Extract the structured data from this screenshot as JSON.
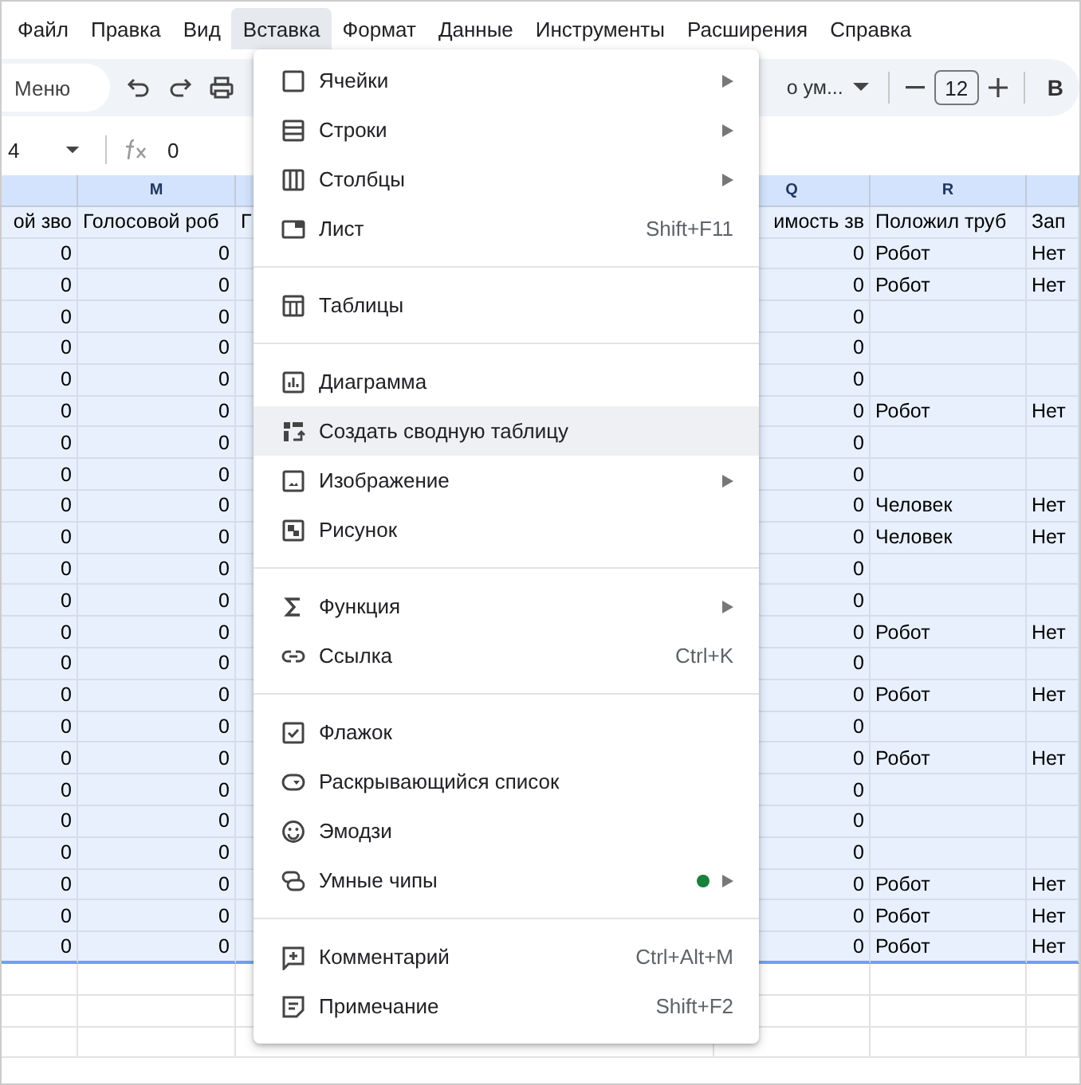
{
  "menubar": [
    {
      "label": "Файл",
      "selected": false
    },
    {
      "label": "Правка",
      "selected": false
    },
    {
      "label": "Вид",
      "selected": false
    },
    {
      "label": "Вставка",
      "selected": true
    },
    {
      "label": "Формат",
      "selected": false
    },
    {
      "label": "Данные",
      "selected": false
    },
    {
      "label": "Инструменты",
      "selected": false
    },
    {
      "label": "Расширения",
      "selected": false
    },
    {
      "label": "Справка",
      "selected": false
    }
  ],
  "toolbar": {
    "search": {
      "placeholder": "Меню"
    },
    "font": "о ум...",
    "font_size": "12",
    "bold": "B"
  },
  "formula_bar": {
    "cell_ref": "4",
    "value": "0"
  },
  "columns": [
    {
      "header": "ой зво"
    },
    {
      "letter": "M",
      "header": "Голосовой роб"
    },
    {
      "header": "Г"
    },
    {
      "letter": "Q",
      "header": "имость зв"
    },
    {
      "letter": "R",
      "header": "Положил труб"
    },
    {
      "header": "Зап"
    }
  ],
  "rows": [
    {
      "cells": [
        "0",
        "0",
        "0",
        "Робот",
        "Нет"
      ]
    },
    {
      "cells": [
        "0",
        "0",
        "0",
        "Робот",
        "Нет"
      ]
    },
    {
      "cells": [
        "0",
        "0",
        "0"
      ]
    },
    {
      "cells": [
        "0",
        "0",
        "0"
      ]
    },
    {
      "cells": [
        "0",
        "0",
        "0"
      ]
    },
    {
      "cells": [
        "0",
        "0",
        "0",
        "Робот",
        "Нет"
      ]
    },
    {
      "cells": [
        "0",
        "0",
        "0"
      ]
    },
    {
      "cells": [
        "0",
        "0",
        "0"
      ]
    },
    {
      "cells": [
        "0",
        "0",
        "0",
        "Человек",
        "Нет"
      ]
    },
    {
      "cells": [
        "0",
        "0",
        "0",
        "Человек",
        "Нет"
      ]
    },
    {
      "cells": [
        "0",
        "0",
        "0"
      ]
    },
    {
      "cells": [
        "0",
        "0",
        "0"
      ]
    },
    {
      "cells": [
        "0",
        "0",
        "0",
        "Робот",
        "Нет"
      ]
    },
    {
      "cells": [
        "0",
        "0",
        "0"
      ]
    },
    {
      "cells": [
        "0",
        "0",
        "0",
        "Робот",
        "Нет"
      ]
    },
    {
      "cells": [
        "0",
        "0",
        "0"
      ]
    },
    {
      "cells": [
        "0",
        "0",
        "0",
        "Робот",
        "Нет"
      ]
    },
    {
      "cells": [
        "0",
        "0",
        "0"
      ]
    },
    {
      "cells": [
        "0",
        "0",
        "0"
      ]
    },
    {
      "cells": [
        "0",
        "0",
        "0"
      ]
    },
    {
      "cells": [
        "0",
        "0",
        "0",
        "Робот",
        "Нет"
      ]
    },
    {
      "cells": [
        "0",
        "0",
        "0",
        "Робот",
        "Нет"
      ]
    },
    {
      "cells": [
        "0",
        "0",
        "0",
        "Робот",
        "Нет"
      ]
    }
  ],
  "menu": {
    "groups": [
      [
        {
          "label": "Ячейки",
          "submenu": true,
          "selected": false,
          "dot": false
        },
        {
          "label": "Строки",
          "submenu": true,
          "selected": false,
          "dot": false
        },
        {
          "label": "Столбцы",
          "submenu": true,
          "selected": false,
          "dot": false
        },
        {
          "label": "Лист",
          "shortcut": "Shift+F11",
          "submenu": false,
          "selected": false,
          "dot": false
        }
      ],
      [
        {
          "label": "Таблицы",
          "submenu": false,
          "selected": false,
          "dot": false
        }
      ],
      [
        {
          "label": "Диаграмма",
          "submenu": false,
          "selected": false,
          "dot": false
        },
        {
          "label": "Создать сводную таблицу",
          "submenu": false,
          "selected": true,
          "dot": false
        },
        {
          "label": "Изображение",
          "submenu": true,
          "selected": false,
          "dot": false
        },
        {
          "label": "Рисунок",
          "submenu": false,
          "selected": false,
          "dot": false
        }
      ],
      [
        {
          "label": "Функция",
          "submenu": true,
          "selected": false,
          "dot": false
        },
        {
          "label": "Ссылка",
          "shortcut": "Ctrl+K",
          "submenu": false,
          "selected": false,
          "dot": false
        }
      ],
      [
        {
          "label": "Флажок",
          "submenu": false,
          "selected": false,
          "dot": false
        },
        {
          "label": "Раскрывающийся список",
          "submenu": false,
          "selected": false,
          "dot": false
        },
        {
          "label": "Эмодзи",
          "submenu": false,
          "selected": false,
          "dot": false
        },
        {
          "label": "Умные чипы",
          "submenu": true,
          "selected": false,
          "dot": true
        }
      ],
      [
        {
          "label": "Комментарий",
          "shortcut": "Ctrl+Alt+M",
          "submenu": false,
          "selected": false,
          "dot": false
        },
        {
          "label": "Примечание",
          "shortcut": "Shift+F2",
          "submenu": false,
          "selected": false,
          "dot": false
        }
      ]
    ]
  }
}
